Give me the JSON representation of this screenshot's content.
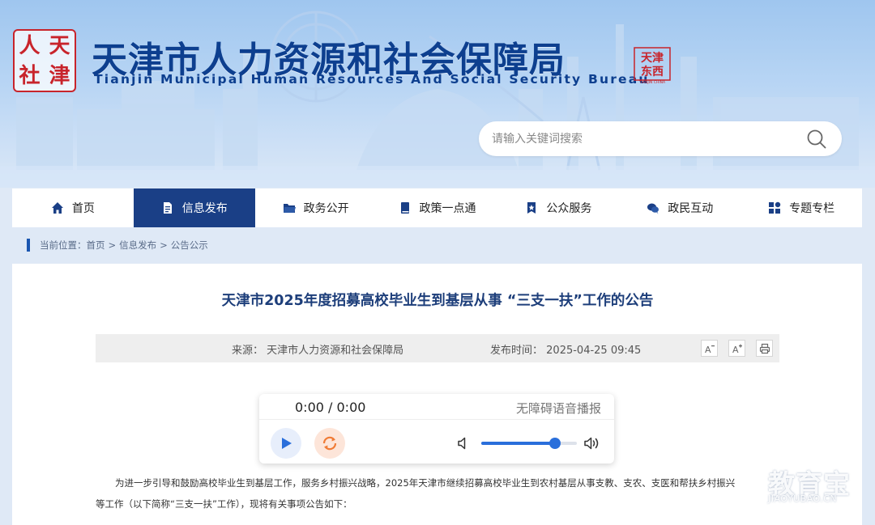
{
  "header": {
    "logo_chars": [
      "人",
      "天",
      "社",
      "津"
    ],
    "title": "天津市人力资源和社会保障局",
    "subtitle": "Tianjin Municipal Human Resources And Social Security Bureau",
    "seal_chars": [
      "天津",
      "东西"
    ],
    "seal_caption": "TIANJIN CHINA"
  },
  "search": {
    "placeholder": "请输入关键词搜索",
    "icon": "search-icon"
  },
  "nav": {
    "items": [
      {
        "label": "首页",
        "icon": "home-icon",
        "active": false
      },
      {
        "label": "信息发布",
        "icon": "document-icon",
        "active": true
      },
      {
        "label": "政务公开",
        "icon": "folder-icon",
        "active": false
      },
      {
        "label": "政策一点通",
        "icon": "book-icon",
        "active": false
      },
      {
        "label": "公众服务",
        "icon": "bookmark-star-icon",
        "active": false
      },
      {
        "label": "政民互动",
        "icon": "chat-icon",
        "active": false
      },
      {
        "label": "专题专栏",
        "icon": "grid-icon",
        "active": false
      }
    ],
    "active_color": "#1a3f86"
  },
  "breadcrumb": {
    "prefix": "当前位置：",
    "items": [
      "首页",
      "信息发布",
      "公告公示"
    ],
    "separator": ">"
  },
  "article": {
    "title": "天津市2025年度招募高校毕业生到基层从事 “三支一扶”工作的公告",
    "source_label": "来源：",
    "source": "天津市人力资源和社会保障局",
    "time_label": "发布时间：",
    "time": "2025-04-25 09:45",
    "tools": {
      "font_decrease": "A-",
      "font_increase": "A+",
      "print_icon": "print-icon"
    },
    "paragraph_line1": "为进一步引导和鼓励高校毕业生到基层工作，服务乡村振兴战略，2025年天津市继续招募高校毕业生到农村基层从事支教、支农、支医和帮扶乡村振兴",
    "paragraph_line2": "等工作（以下简称“三支一扶”工作），现将有关事项公告如下："
  },
  "player": {
    "time_display": "0:00 / 0:00",
    "label": "无障碍语音播报",
    "volume": 0.77,
    "accent": "#2a6fdb"
  },
  "watermark": {
    "cn": "教育宝",
    "en": "JIAOYUBAO.CN"
  }
}
